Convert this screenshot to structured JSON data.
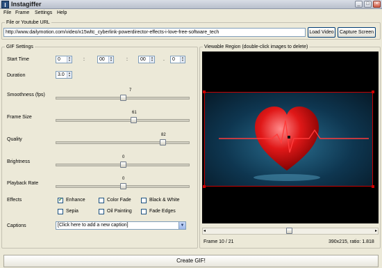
{
  "window": {
    "title": "Instagiffer",
    "icon_letter": "I"
  },
  "menu": [
    "File",
    "Frame",
    "Settings",
    "Help"
  ],
  "source": {
    "group_label": "File or Youtube URL",
    "url_value": "http://www.dailymotion.com/video/x15wltc_cyberlink-powerdirector-effects-i-love-free-software_tech",
    "load_button": "Load Video",
    "capture_button": "Capture Screen"
  },
  "gif_settings": {
    "group_label": "GIF Settings",
    "start_time_label": "Start Time",
    "start_time": {
      "h": "0",
      "m": "00",
      "s": "00",
      "ms": "0",
      "sep1": ":",
      "sep2": ":",
      "sep3": "."
    },
    "duration_label": "Duration",
    "duration_value": "3.0",
    "smoothness_label": "Smoothness (fps)",
    "smoothness_value": "7",
    "smoothness_fraction": 0.5,
    "frame_size_label": "Frame Size",
    "frame_size_value": "61",
    "frame_size_fraction": 0.58,
    "quality_label": "Quality",
    "quality_value": "82",
    "quality_fraction": 0.8,
    "brightness_label": "Brightness",
    "brightness_value": "0",
    "brightness_fraction": 0.5,
    "playback_rate_label": "Playback Rate",
    "playback_rate_value": "0",
    "playback_rate_fraction": 0.5,
    "effects_label": "Effects",
    "effects": [
      {
        "label": "Enhance",
        "checked": true
      },
      {
        "label": "Color Fade",
        "checked": false
      },
      {
        "label": "Black & White",
        "checked": false
      },
      {
        "label": "Sepia",
        "checked": false
      },
      {
        "label": "Oil Painting",
        "checked": false
      },
      {
        "label": "Fade Edges",
        "checked": false
      }
    ],
    "captions_label": "Captions",
    "captions_value": "[Click here to add a new caption]"
  },
  "viewer": {
    "group_label": "Viewable Region (double-click images to delete)",
    "frame_text": "Frame  10 / 21",
    "size_text": "390x215, ratio: 1.818",
    "scroll_fraction": 0.48
  },
  "create_button": "Create GIF!",
  "colors": {
    "selection": "#c60000",
    "viewer_bg": "#000000",
    "accent": "#003c74"
  },
  "icons": {
    "window": "app-icon",
    "minimize": "minimize-icon",
    "maximize": "maximize-icon",
    "close": "close-icon",
    "dropdown": "chevron-down-icon"
  }
}
